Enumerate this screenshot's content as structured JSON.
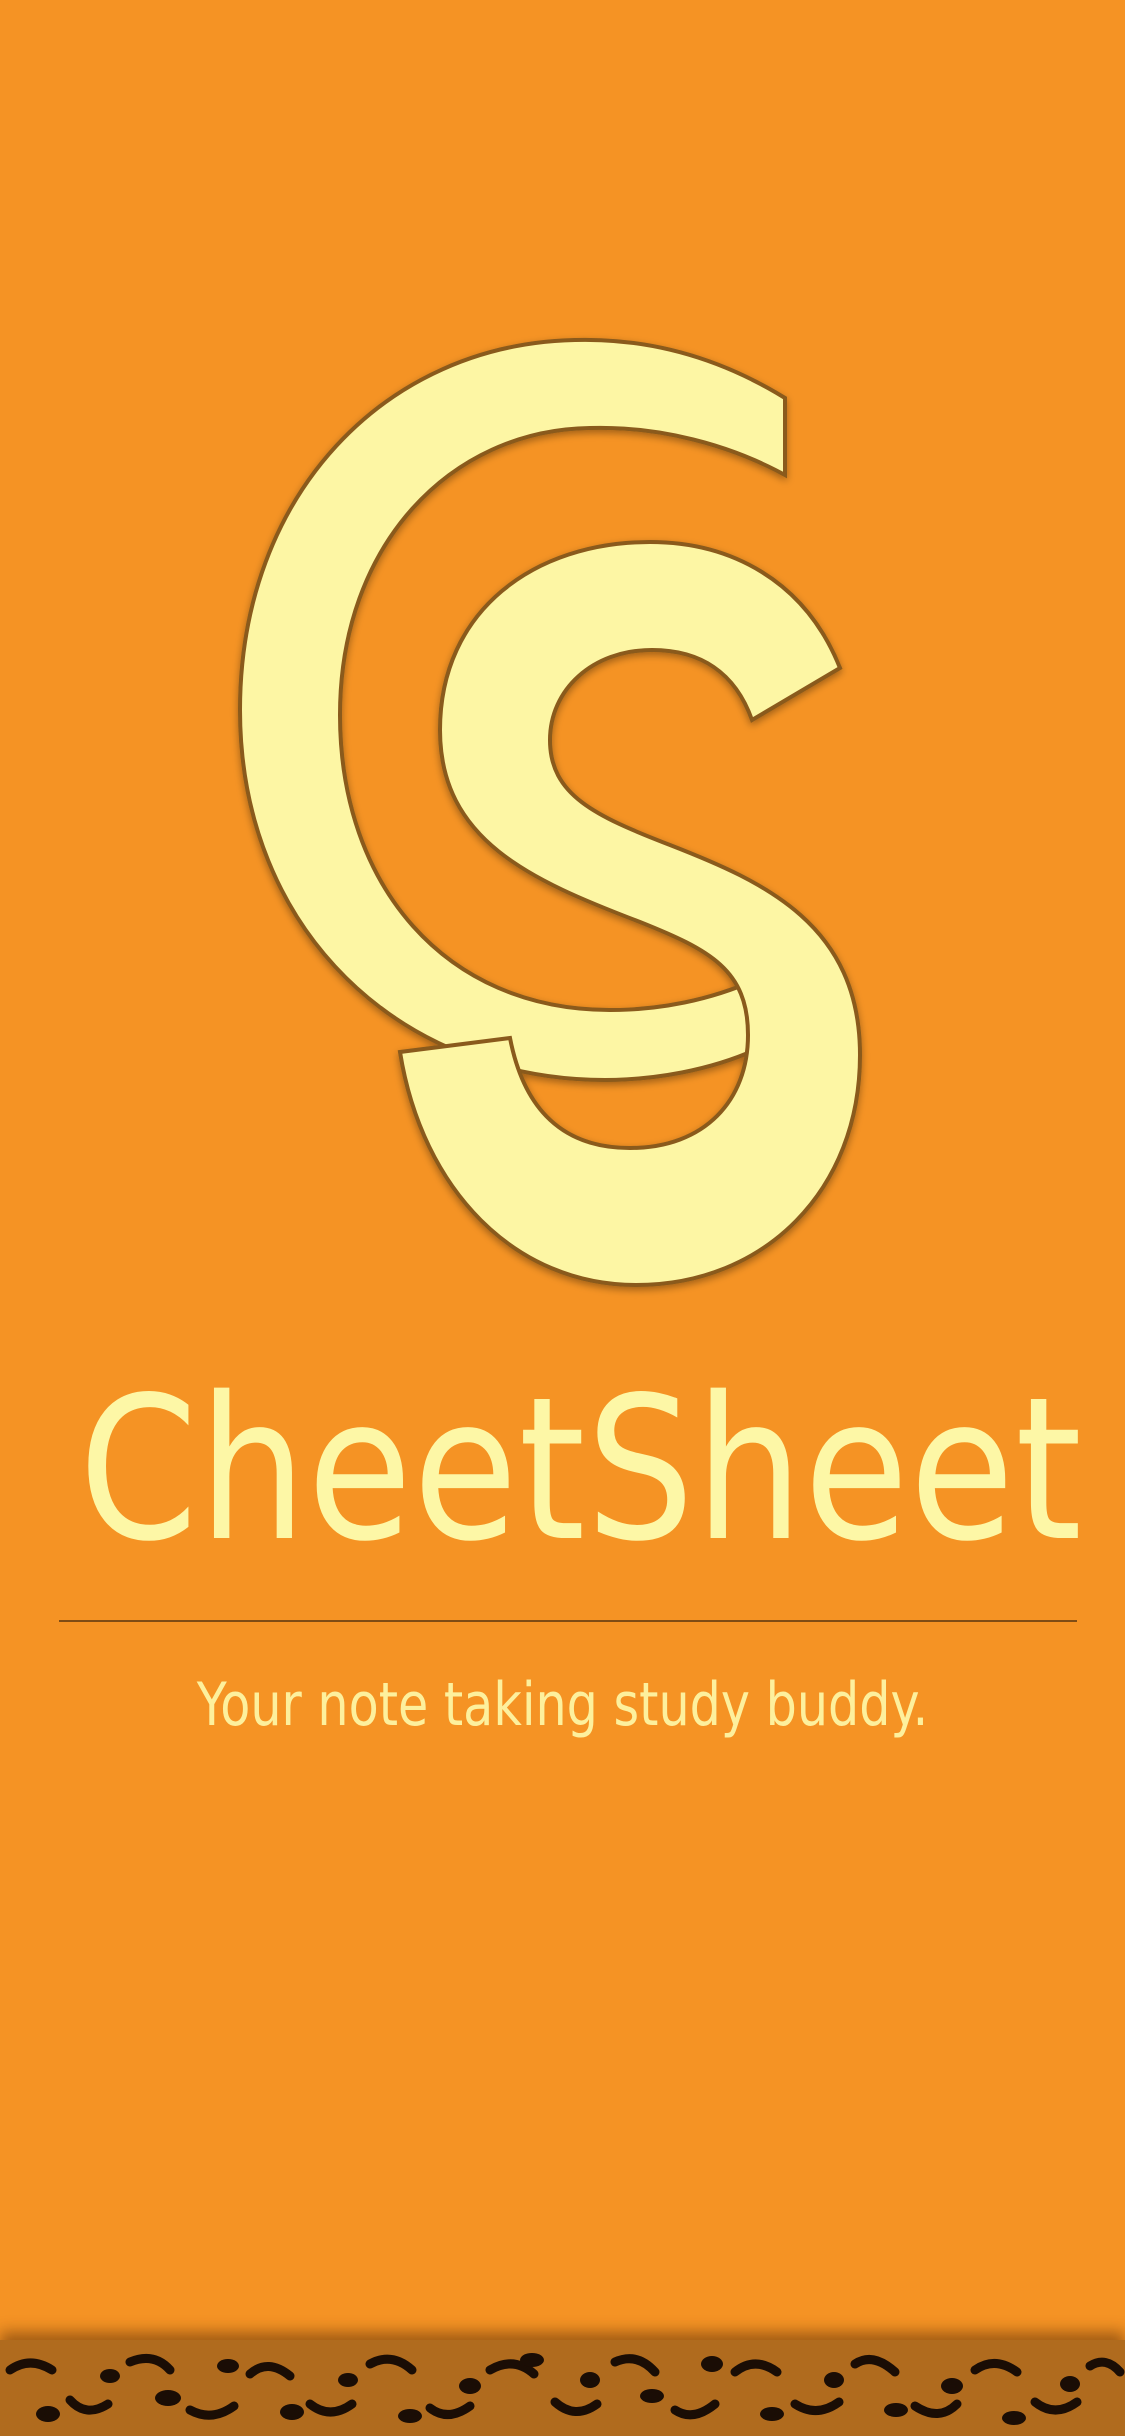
{
  "splash": {
    "app_name": "CheetSheet",
    "tagline": "Your note taking study buddy."
  },
  "icons": {
    "logo": "cs-monogram-logo",
    "bottom_pattern": "leopard-print"
  },
  "colors": {
    "background": "#f59324",
    "logo_fill": "#fdf6a4",
    "logo_outline": "#8a5a1a",
    "title_text": "#fdf7a6",
    "tagline_text": "#fdf09d",
    "divider": "#6a3f12",
    "leopard_base": "#b06b1e",
    "leopard_spots": "#1a0d05"
  }
}
